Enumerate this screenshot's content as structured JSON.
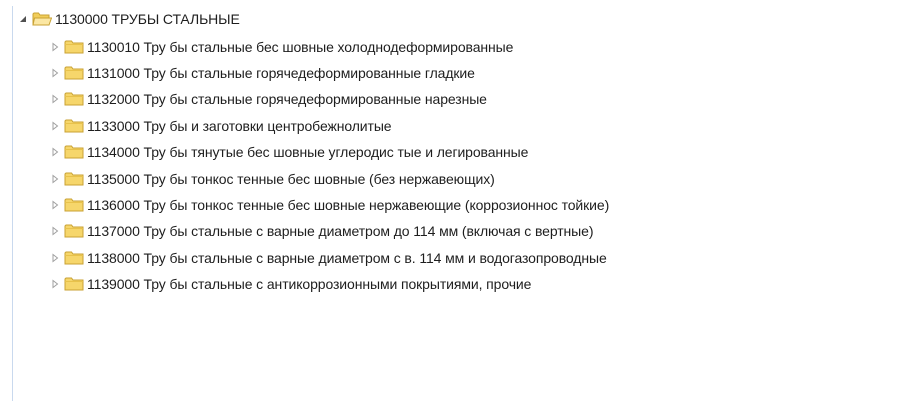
{
  "tree": {
    "root": {
      "label": "1130000 ТРУБЫ СТАЛЬНЫЕ",
      "expanded": true,
      "icon": "folder-open-icon"
    },
    "children": [
      {
        "label": "1130010 Тру бы стальные бес шовные холоднодеформированные",
        "expanded": false,
        "icon": "folder-icon"
      },
      {
        "label": "1131000 Тру бы стальные горячедеформированные гладкие",
        "expanded": false,
        "icon": "folder-icon"
      },
      {
        "label": "1132000 Тру бы стальные горячедеформированные нарезные",
        "expanded": false,
        "icon": "folder-icon"
      },
      {
        "label": "1133000 Тру бы и заготовки центробежнолитые",
        "expanded": false,
        "icon": "folder-icon"
      },
      {
        "label": "1134000 Тру бы тянутые бес шовные углеродис тые и легированные",
        "expanded": false,
        "icon": "folder-icon"
      },
      {
        "label": "1135000 Тру бы тонкос тенные бес шовные (без нержавеющих)",
        "expanded": false,
        "icon": "folder-icon"
      },
      {
        "label": "1136000 Тру бы тонкос тенные бес шовные нержавеющие (коррозионнос тойкие)",
        "expanded": false,
        "icon": "folder-icon"
      },
      {
        "label": "1137000 Тру бы стальные с варные диаметром до 114 мм (включая с вертные)",
        "expanded": false,
        "icon": "folder-icon"
      },
      {
        "label": "1138000 Тру бы стальные с варные диаметром с в. 114 мм и водогазопроводные",
        "expanded": false,
        "icon": "folder-icon"
      },
      {
        "label": "1139000 Тру бы стальные с антикоррозионными покрытиями, прочие",
        "expanded": false,
        "icon": "folder-icon"
      }
    ]
  },
  "colors": {
    "folder_fill": "#f6d66b",
    "folder_stroke": "#c9a233",
    "expander_open": "#505050",
    "expander_closed": "#a0a0a0",
    "guide_line": "#c9d9ee",
    "text": "#1e1e1e"
  }
}
